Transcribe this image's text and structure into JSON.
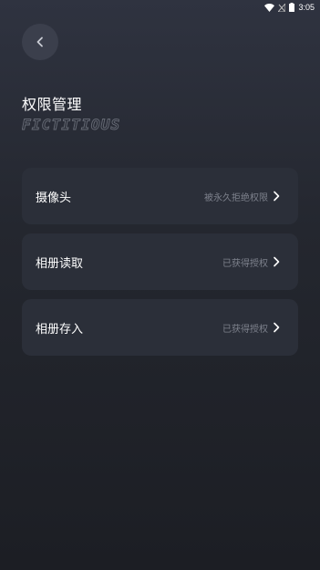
{
  "status_bar": {
    "time": "3:05",
    "icons": [
      "wifi-icon",
      "signal-icon",
      "battery-icon"
    ]
  },
  "header": {
    "back_icon": "chevron-left-icon",
    "title": "权限管理",
    "brand_text": "FICTITIOUS"
  },
  "permissions": [
    {
      "name": "摄像头",
      "status": "被永久拒绝权限",
      "icon": "chevron-right-icon"
    },
    {
      "name": "相册读取",
      "status": "已获得授权",
      "icon": "chevron-right-icon"
    },
    {
      "name": "相册存入",
      "status": "已获得授权",
      "icon": "chevron-right-icon"
    }
  ],
  "colors": {
    "background_top": "#2f3340",
    "background_bottom": "#1c1e24",
    "card": "#2b2f39",
    "status_text": "#7d818c",
    "back_button_bg": "#3b3f4c"
  }
}
